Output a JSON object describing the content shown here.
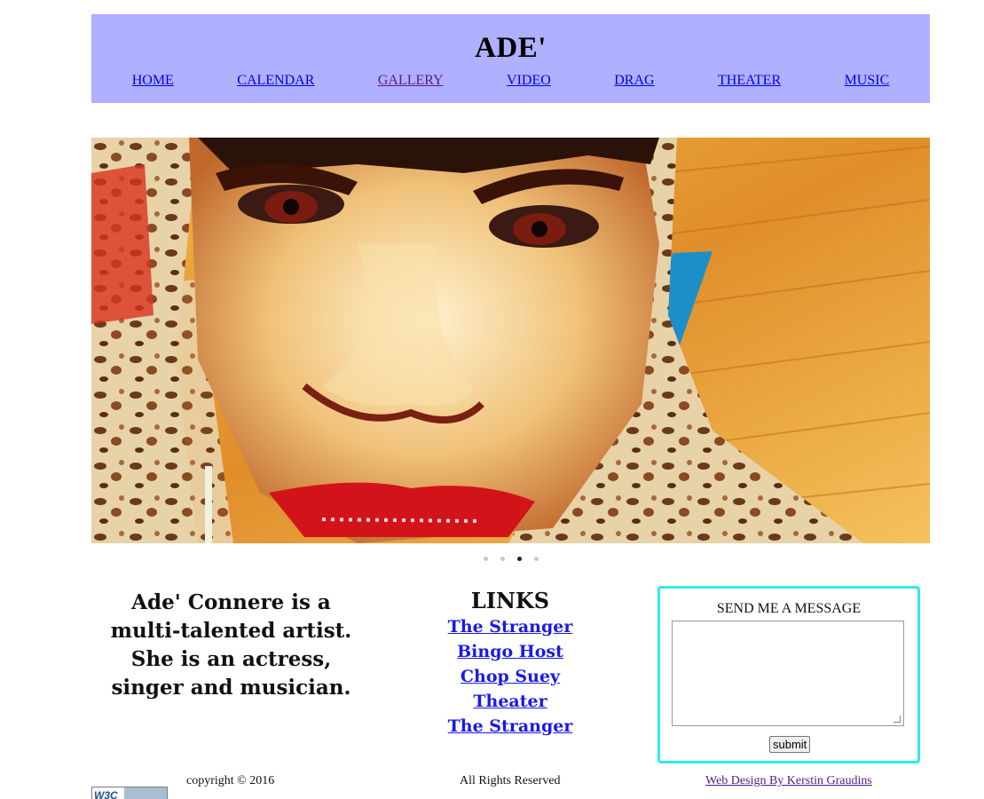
{
  "header": {
    "title": "ADE'",
    "background": "#afb0ff",
    "nav": [
      {
        "label": "HOME"
      },
      {
        "label": "CALENDAR"
      },
      {
        "label": "GALLERY",
        "visited": true
      },
      {
        "label": "VIDEO"
      },
      {
        "label": "DRAG"
      },
      {
        "label": "THEATER"
      },
      {
        "label": "MUSIC"
      }
    ]
  },
  "slider": {
    "dot_count": 4,
    "active_dot": 3
  },
  "bio": {
    "text": "Ade' Connere is a multi-talented artist. She is an actress, singer and musician."
  },
  "links": {
    "heading": "LINKS",
    "items": [
      {
        "label": "The Stranger"
      },
      {
        "label": "Bingo Host"
      },
      {
        "label": "Chop Suey"
      },
      {
        "label": "Theater"
      },
      {
        "label": "The Stranger"
      }
    ]
  },
  "message": {
    "title": "SEND ME A MESSAGE",
    "textarea_value": "",
    "submit_label": "submit",
    "border_color": "#33e8ea"
  },
  "footer": {
    "copyright": "copyright © 2016",
    "rights": "All Rights Reserved",
    "credit": "Web Design By Kerstin Graudins",
    "badge_text": "W3C"
  }
}
